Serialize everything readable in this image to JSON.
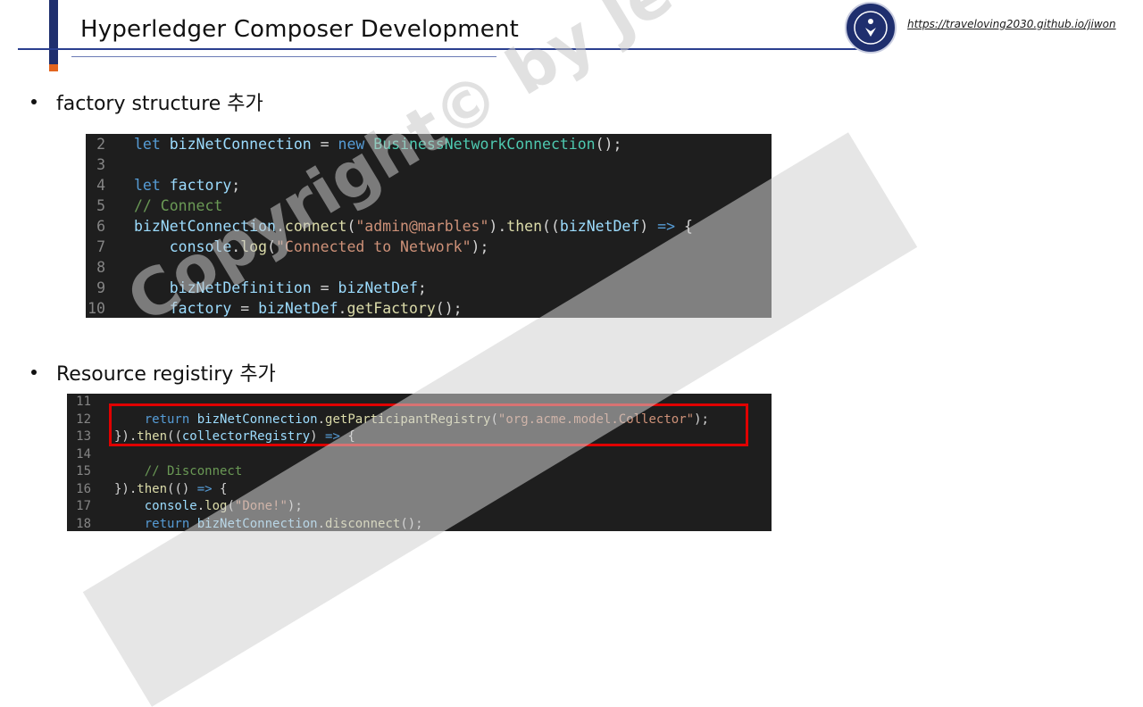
{
  "header": {
    "title": "Hyperledger Composer Development",
    "url": "https://traveloving2030.github.io/jiwon"
  },
  "sections": [
    {
      "bullet": "factory structure 추가"
    },
    {
      "bullet": "Resource registiry 추가"
    }
  ],
  "code_block_1": {
    "lines": [
      {
        "num": "2",
        "tokens": [
          [
            "kw",
            "let "
          ],
          [
            "var",
            "bizNetConnection"
          ],
          [
            "pl",
            " = "
          ],
          [
            "kw",
            "new "
          ],
          [
            "cls",
            "BusinessNetworkConnection"
          ],
          [
            "pl",
            "();"
          ]
        ]
      },
      {
        "num": "3",
        "tokens": []
      },
      {
        "num": "4",
        "tokens": [
          [
            "kw",
            "let "
          ],
          [
            "var",
            "factory"
          ],
          [
            "pl",
            ";"
          ]
        ]
      },
      {
        "num": "5",
        "tokens": [
          [
            "cm",
            "// Connect"
          ]
        ]
      },
      {
        "num": "6",
        "tokens": [
          [
            "var",
            "bizNetConnection"
          ],
          [
            "pl",
            "."
          ],
          [
            "fn",
            "connect"
          ],
          [
            "pl",
            "("
          ],
          [
            "str",
            "\"admin@marbles\""
          ],
          [
            "pl",
            ")."
          ],
          [
            "fn",
            "then"
          ],
          [
            "pl",
            "(("
          ],
          [
            "var",
            "bizNetDef"
          ],
          [
            "pl",
            ") "
          ],
          [
            "kw",
            "=>"
          ],
          [
            "pl",
            " {"
          ]
        ]
      },
      {
        "num": "7",
        "tokens": [
          [
            "pl",
            "    "
          ],
          [
            "var",
            "console"
          ],
          [
            "pl",
            "."
          ],
          [
            "fn",
            "log"
          ],
          [
            "pl",
            "("
          ],
          [
            "str",
            "\"Connected to Network\""
          ],
          [
            "pl",
            ");"
          ]
        ]
      },
      {
        "num": "8",
        "tokens": []
      },
      {
        "num": "9",
        "tokens": [
          [
            "pl",
            "    "
          ],
          [
            "var",
            "bizNetDefinition"
          ],
          [
            "pl",
            " = "
          ],
          [
            "var",
            "bizNetDef"
          ],
          [
            "pl",
            ";"
          ]
        ]
      },
      {
        "num": "10",
        "tokens": [
          [
            "pl",
            "    "
          ],
          [
            "var",
            "factory"
          ],
          [
            "pl",
            " = "
          ],
          [
            "var",
            "bizNetDef"
          ],
          [
            "pl",
            "."
          ],
          [
            "fn",
            "getFactory"
          ],
          [
            "pl",
            "();"
          ]
        ]
      }
    ]
  },
  "code_block_2": {
    "lines": [
      {
        "num": "11",
        "tokens": []
      },
      {
        "num": "12",
        "tokens": [
          [
            "pl",
            "    "
          ],
          [
            "kw",
            "return "
          ],
          [
            "var",
            "bizNetConnection"
          ],
          [
            "pl",
            "."
          ],
          [
            "fn",
            "getParticipantRegistry"
          ],
          [
            "pl",
            "("
          ],
          [
            "str",
            "\"org.acme.model.Collector\""
          ],
          [
            "pl",
            ");"
          ]
        ]
      },
      {
        "num": "13",
        "tokens": [
          [
            "pl",
            "})."
          ],
          [
            "fn",
            "then"
          ],
          [
            "pl",
            "(("
          ],
          [
            "var",
            "collectorRegistry"
          ],
          [
            "pl",
            ") "
          ],
          [
            "kw",
            "=>"
          ],
          [
            "pl",
            " {"
          ]
        ]
      },
      {
        "num": "14",
        "tokens": []
      },
      {
        "num": "15",
        "tokens": [
          [
            "pl",
            "    "
          ],
          [
            "cm",
            "// Disconnect"
          ]
        ]
      },
      {
        "num": "16",
        "tokens": [
          [
            "pl",
            "})."
          ],
          [
            "fn",
            "then"
          ],
          [
            "pl",
            "(() "
          ],
          [
            "kw",
            "=>"
          ],
          [
            "pl",
            " {"
          ]
        ]
      },
      {
        "num": "17",
        "tokens": [
          [
            "pl",
            "    "
          ],
          [
            "var",
            "console"
          ],
          [
            "pl",
            "."
          ],
          [
            "fn",
            "log"
          ],
          [
            "pl",
            "("
          ],
          [
            "str",
            "\"Done!\""
          ],
          [
            "pl",
            ");"
          ]
        ]
      },
      {
        "num": "18",
        "tokens": [
          [
            "pl",
            "    "
          ],
          [
            "kw",
            "return "
          ],
          [
            "var",
            "bizNetConnection"
          ],
          [
            "pl",
            "."
          ],
          [
            "fn",
            "disconnect"
          ],
          [
            "pl",
            "();"
          ]
        ]
      }
    ]
  },
  "watermark": "Copyright© by Jeong JiWon",
  "colors": {
    "accent_navy": "#1f2f6e",
    "accent_orange": "#e2651f",
    "code_bg": "#1e1e1e",
    "highlight_red": "#e00000"
  }
}
